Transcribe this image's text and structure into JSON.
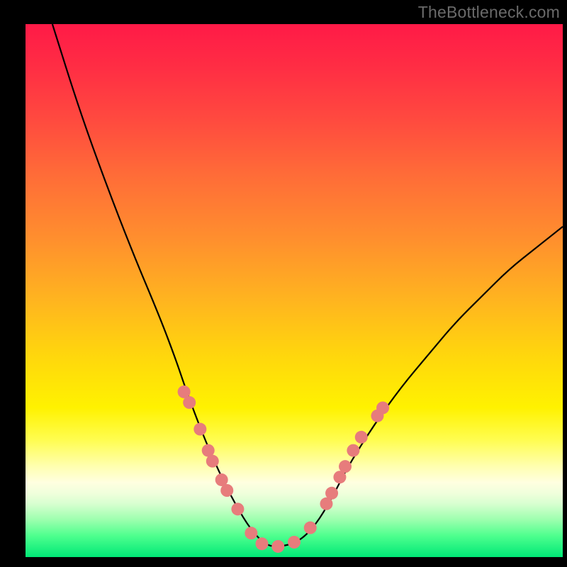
{
  "watermark": "TheBottleneck.com",
  "chart_data": {
    "type": "line",
    "title": "",
    "xlabel": "",
    "ylabel": "",
    "xlim": [
      0,
      100
    ],
    "ylim": [
      0,
      100
    ],
    "description": "V-shaped bottleneck curve on vertical gradient (red at top through orange/yellow to green at bottom). Minimum of curve sits in green band near x≈45. Salmon dots cluster on both flanks of the V in the yellow/pale band.",
    "series": [
      {
        "name": "curve",
        "x": [
          5,
          10,
          15,
          20,
          25,
          28,
          30,
          33,
          36,
          39,
          42,
          45,
          48,
          51,
          54,
          57,
          60,
          65,
          70,
          75,
          80,
          85,
          90,
          95,
          100
        ],
        "y": [
          100,
          84,
          70,
          57,
          45,
          37,
          31,
          23,
          16,
          10,
          5,
          2,
          2,
          3,
          6,
          11,
          17,
          25,
          32,
          38,
          44,
          49,
          54,
          58,
          62
        ]
      }
    ],
    "dots": {
      "color": "#e77c7c",
      "radius_px": 9,
      "points": [
        {
          "x": 29.5,
          "y": 31
        },
        {
          "x": 30.5,
          "y": 29
        },
        {
          "x": 32.5,
          "y": 24
        },
        {
          "x": 34.0,
          "y": 20
        },
        {
          "x": 34.8,
          "y": 18
        },
        {
          "x": 36.5,
          "y": 14.5
        },
        {
          "x": 37.5,
          "y": 12.5
        },
        {
          "x": 39.5,
          "y": 9
        },
        {
          "x": 42.0,
          "y": 4.5
        },
        {
          "x": 44.0,
          "y": 2.5
        },
        {
          "x": 47.0,
          "y": 2.0
        },
        {
          "x": 50.0,
          "y": 2.8
        },
        {
          "x": 53.0,
          "y": 5.5
        },
        {
          "x": 56.0,
          "y": 10
        },
        {
          "x": 57.0,
          "y": 12
        },
        {
          "x": 58.5,
          "y": 15
        },
        {
          "x": 59.5,
          "y": 17
        },
        {
          "x": 61.0,
          "y": 20
        },
        {
          "x": 62.5,
          "y": 22.5
        },
        {
          "x": 65.5,
          "y": 26.5
        },
        {
          "x": 66.5,
          "y": 28
        }
      ]
    },
    "gradient_stops": [
      {
        "pos": 0.0,
        "color": "#ff1a47"
      },
      {
        "pos": 0.5,
        "color": "#ffb51f"
      },
      {
        "pos": 0.72,
        "color": "#fff200"
      },
      {
        "pos": 0.86,
        "color": "#ffffe0"
      },
      {
        "pos": 1.0,
        "color": "#00e876"
      }
    ]
  }
}
